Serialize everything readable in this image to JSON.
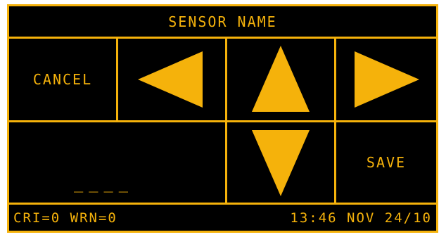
{
  "header": {
    "title": "SENSOR NAME"
  },
  "buttons": {
    "cancel_label": "CANCEL",
    "save_label": "SAVE",
    "left_icon": "arrow-left-icon",
    "up_icon": "arrow-up-icon",
    "right_icon": "arrow-right-icon",
    "down_icon": "arrow-down-icon"
  },
  "entry": {
    "value": "____"
  },
  "status": {
    "counts": "CRI=0 WRN=0",
    "datetime": "13:46 NOV 24/10"
  },
  "colors": {
    "accent": "#f5b20b",
    "background": "#000000"
  }
}
